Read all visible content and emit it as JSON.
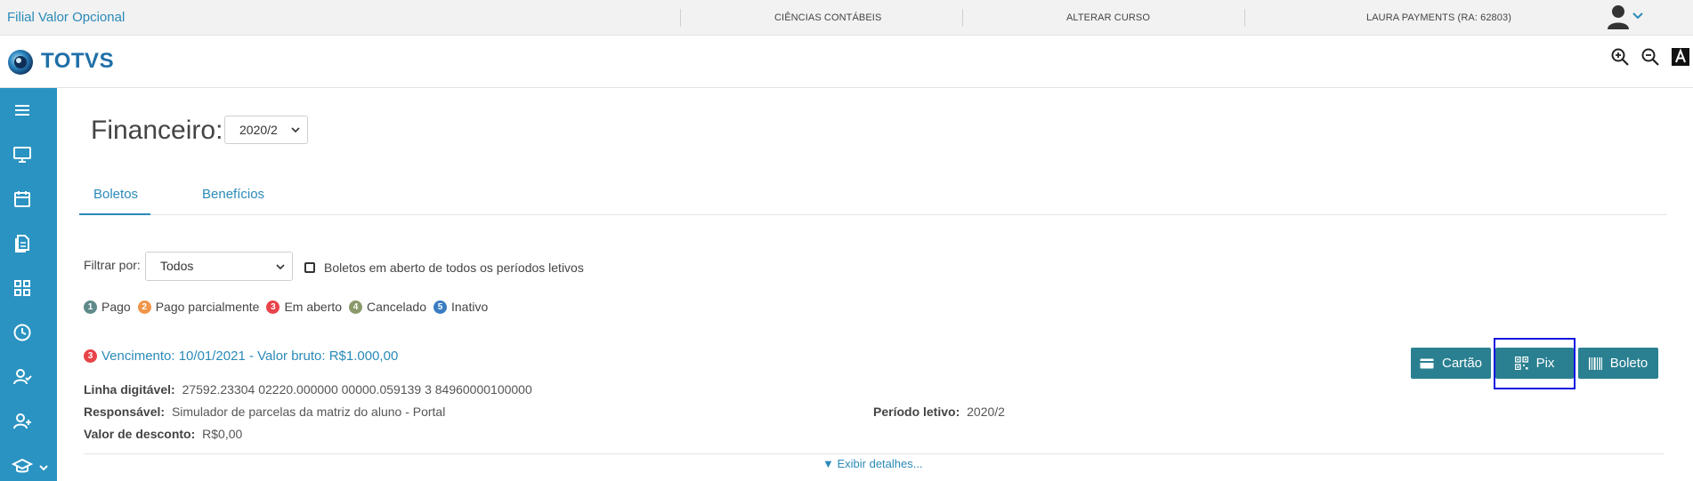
{
  "topbar": {
    "brand": "Filial Valor Opcional",
    "menu": [
      "CIÊNCIAS CONTÁBEIS",
      "ALTERAR CURSO",
      "LAURA PAYMENTS (RA: 62803)"
    ]
  },
  "header": {
    "logo": "TOTVS"
  },
  "page": {
    "title": "Financeiro:",
    "year": "2020/2"
  },
  "tabs": [
    "Boletos",
    "Benefícios"
  ],
  "filter": {
    "label": "Filtrar por:",
    "value": "Todos",
    "checkbox_label": "Boletos em aberto de todos os períodos letivos"
  },
  "legend": [
    {
      "num": "1",
      "label": "Pago",
      "color": "#5f8a8b"
    },
    {
      "num": "2",
      "label": "Pago parcialmente",
      "color": "#f0954a"
    },
    {
      "num": "3",
      "label": "Em aberto",
      "color": "#e8434a"
    },
    {
      "num": "4",
      "label": "Cancelado",
      "color": "#8b9a6b"
    },
    {
      "num": "5",
      "label": "Inativo",
      "color": "#3a7cc0"
    }
  ],
  "boleto": {
    "status_num": "3",
    "due": "Vencimento: 10/01/2021 - Valor bruto: R$1.000,00",
    "linha_label": "Linha digitável:",
    "linha_value": "27592.23304 02220.000000 00000.059139 3 84960000100000",
    "resp_label": "Responsável:",
    "resp_value": "Simulador de parcelas da matriz do aluno - Portal",
    "periodo_label": "Período letivo:",
    "periodo_value": "2020/2",
    "desconto_label": "Valor de desconto:",
    "desconto_value": "R$0,00"
  },
  "buttons": {
    "cartao": "Cartão",
    "pix": "Pix",
    "boleto": "Boleto"
  },
  "details_link": "▼ Exibir detalhes..."
}
